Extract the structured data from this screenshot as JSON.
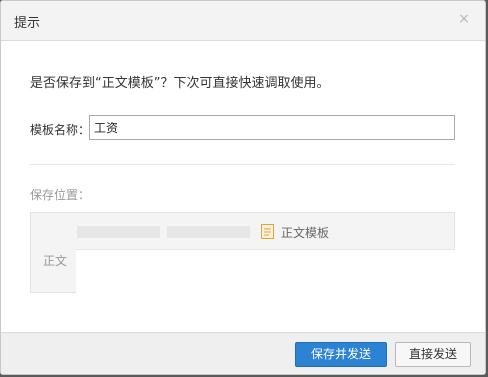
{
  "dialog": {
    "title": "提示",
    "close_glyph": "×",
    "prompt": "是否保存到“正文模板”？下次可直接快速调取使用。",
    "name_label": "模板名称：",
    "name_value": "工资",
    "location_label": "保存位置：",
    "folder_name": "正文模板",
    "body_label": "正文",
    "save_send_label": "保存并发送",
    "send_label": "直接发送"
  },
  "colors": {
    "primary": "#2c82d3",
    "folder_icon": "#e1a341"
  }
}
